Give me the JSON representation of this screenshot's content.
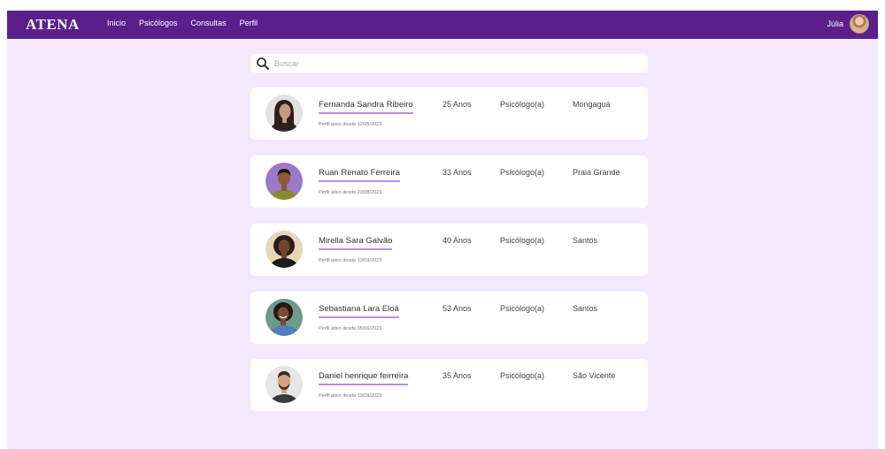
{
  "app": {
    "brand": "ATENA",
    "nav": [
      "Inicio",
      "Psicólogos",
      "Consultas",
      "Perfil"
    ],
    "user_name": "Júlia"
  },
  "search": {
    "placeholder": "Buscar",
    "value": ""
  },
  "icons": {
    "search": "search-icon",
    "user": "user-avatar"
  },
  "colors": {
    "navbar": "#5b1f8c",
    "background": "#f3e8fd",
    "name_underline": "#b88ee6"
  },
  "psychologists": [
    {
      "name": "Fernanda Sandra Ribeiro",
      "since": "Perfil ativo desde 12/05/2023",
      "age": "25 Anos",
      "role": "Psicólogo(a)",
      "city": "Mongaguá"
    },
    {
      "name": "Ruan Renato Ferreira",
      "since": "Perfil ativo desde 23/08/2023",
      "age": "33 Anos",
      "role": "Psicólogo(a)",
      "city": "Praia Grande"
    },
    {
      "name": "Mirella Sara Galvão",
      "since": "Perfil ativo desde 13/03/2023",
      "age": "40 Anos",
      "role": "Psicólogo(a)",
      "city": "Santos"
    },
    {
      "name": "Sebastiana Lara Eloá",
      "since": "Perfil ativo desde 05/06/2023",
      "age": "53 Anos",
      "role": "Psicólogo(a)",
      "city": "Santos"
    },
    {
      "name": "Daniel henrique feirreira",
      "since": "Perfil ativo desde 19/09/2023",
      "age": "35 Anos",
      "role": "Psicólogo(a)",
      "city": "São Vicente"
    }
  ]
}
